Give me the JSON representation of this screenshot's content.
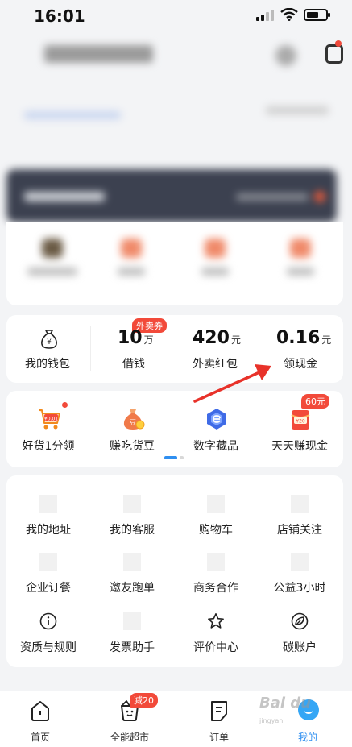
{
  "status_bar": {
    "time": "16:01"
  },
  "wallet": {
    "my_wallet": "我的钱包",
    "items": [
      {
        "value": "10",
        "unit": "万",
        "label": "借钱",
        "badge": "外卖券"
      },
      {
        "value": "420",
        "unit": "元",
        "label": "外卖红包"
      },
      {
        "value": "0.16",
        "unit": "元",
        "label": "领现金"
      }
    ]
  },
  "promos": [
    {
      "label": "好货1分领",
      "icon": "cart-icon",
      "icon_text": "¥0.01"
    },
    {
      "label": "赚吃货豆",
      "icon": "coin-bag-icon",
      "icon_text": "豆"
    },
    {
      "label": "数字藏品",
      "icon": "digital-collectible-icon"
    },
    {
      "label": "天天赚现金",
      "icon": "red-packet-icon",
      "icon_text": "¥20",
      "badge": "60元"
    }
  ],
  "services": [
    {
      "label": "我的地址"
    },
    {
      "label": "我的客服"
    },
    {
      "label": "购物车"
    },
    {
      "label": "店铺关注"
    },
    {
      "label": "企业订餐"
    },
    {
      "label": "邀友跑单"
    },
    {
      "label": "商务合作"
    },
    {
      "label": "公益3小时"
    },
    {
      "label": "资质与规则",
      "icon": "info-icon"
    },
    {
      "label": "发票助手"
    },
    {
      "label": "评价中心",
      "icon": "star-icon"
    },
    {
      "label": "碳账户",
      "icon": "leaf-icon"
    }
  ],
  "tabs": [
    {
      "label": "首页",
      "icon": "home-icon"
    },
    {
      "label": "全能超市",
      "icon": "supermarket-icon",
      "badge": "减20"
    },
    {
      "label": "订单",
      "icon": "order-icon"
    },
    {
      "label": "我的",
      "icon": "profile-icon",
      "active": true
    }
  ],
  "colors": {
    "accent": "#2f8ff0",
    "badge_red": "#f24a3a",
    "annotation_arrow": "#e8322a"
  }
}
